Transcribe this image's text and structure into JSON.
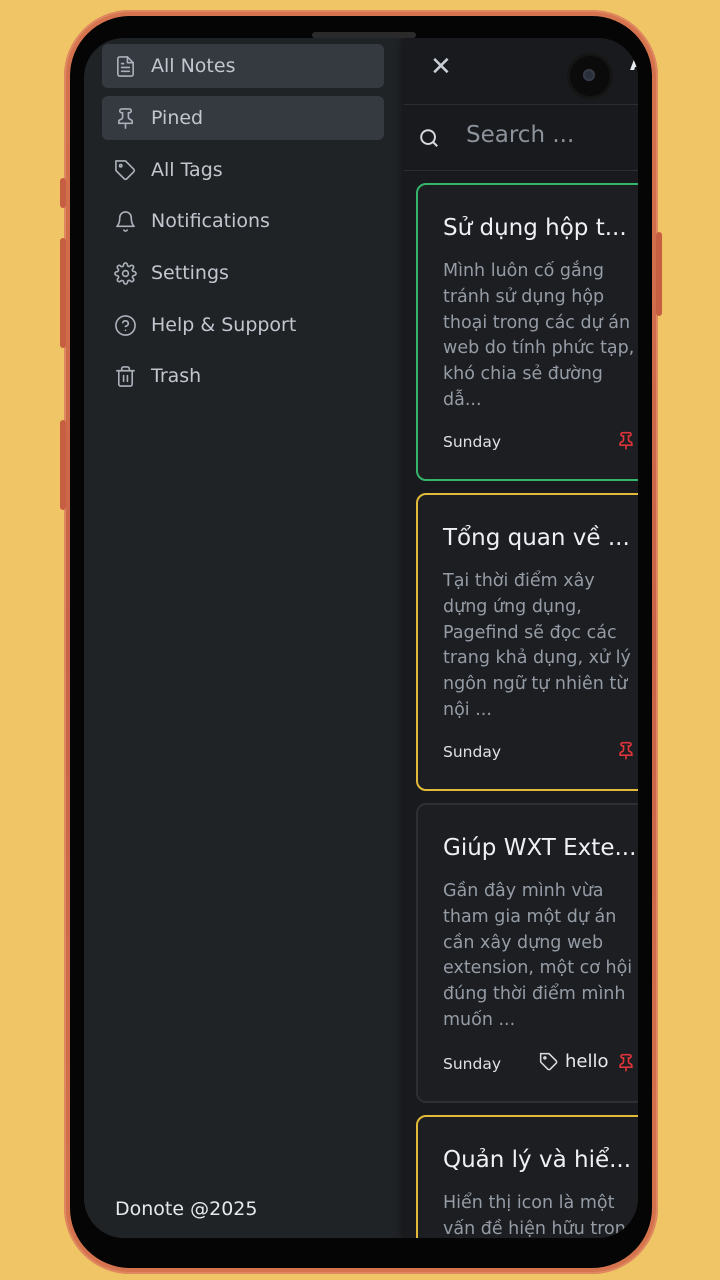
{
  "sidebar": {
    "items": [
      {
        "label": "All Notes",
        "icon": "file-text-icon"
      },
      {
        "label": "Pined",
        "icon": "pin-icon"
      },
      {
        "label": "All Tags",
        "icon": "tag-icon"
      },
      {
        "label": "Notifications",
        "icon": "bell-icon"
      },
      {
        "label": "Settings",
        "icon": "gear-icon"
      },
      {
        "label": "Help & Support",
        "icon": "help-circle-icon"
      },
      {
        "label": "Trash",
        "icon": "trash-icon"
      }
    ],
    "footer": "Donote @2025"
  },
  "header": {
    "avatar_letter": "A"
  },
  "search": {
    "placeholder": "Search ..."
  },
  "notes": [
    {
      "title": "Sử dụng hộp t...",
      "excerpt": "Mình luôn cố gắng tránh sử dụng hộp thoại trong các dự án web do tính phức tạp, khó chia sẻ đường dẫ...",
      "date": "Sunday",
      "pinned": true,
      "border_color": "#34b56b"
    },
    {
      "title": "Tổng quan về ...",
      "excerpt": "Tại thời điểm xây dựng ứng dụng, Pagefind sẽ đọc các trang khả dụng, xử lý ngôn ngữ tự nhiên từ nội ...",
      "date": "Sunday",
      "pinned": true,
      "border_color": "#e2b93b"
    },
    {
      "title": "Giúp WXT Exte...",
      "excerpt": "Gần đây mình vừa tham gia một dự án cần xây dựng web extension, một cơ hội đúng thời điểm mình muốn ...",
      "date": "Sunday",
      "tag": "hello",
      "pinned": true,
      "border_color": "#2c2f33"
    },
    {
      "title": "Quản lý và hiể...",
      "excerpt": "Hiển thị icon là một vấn đề hiện hữu trong",
      "border_color": "#e2b93b"
    }
  ]
}
